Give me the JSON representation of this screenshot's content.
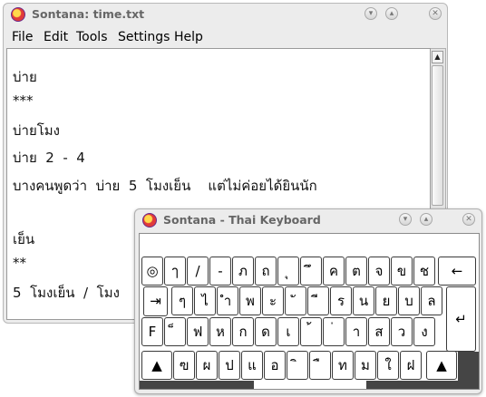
{
  "editor": {
    "title": "Sontana: time.txt",
    "buttons": {
      "minimize": "▾",
      "maximize": "▴",
      "close": "✕"
    },
    "menu": [
      "File",
      "Edit",
      "Tools",
      "Settings",
      "Help"
    ],
    "lines": [
      "บ่าย",
      "***",
      "บ่ายโมง",
      "บ่าย  2  -  4",
      "บางคนพูดว่า  บ่าย  5  โมงเย็น    แต่ไม่ค่อยได้ยินนัก",
      "",
      "เย็น",
      "**",
      "5  โมงเย็น  /  โมง"
    ],
    "scroll_up": "▲"
  },
  "keyboard": {
    "title": "Sontana - Thai Keyboard",
    "buttons": {
      "minimize": "▾",
      "maximize": "▴",
      "close": "✕"
    },
    "row1": [
      "◎",
      "ๅ",
      "/",
      "-",
      "ภ",
      "ถ",
      "ุ",
      "ึ",
      "ค",
      "ต",
      "จ",
      "ข",
      "ช"
    ],
    "backspace": "←",
    "tab": "⇥",
    "row2": [
      "ๆ",
      "ไ",
      "ำ",
      "พ",
      "ะ",
      "ั",
      "ี",
      "ร",
      "น",
      "ย",
      "บ",
      "ล"
    ],
    "enter": "↵",
    "caps": "F",
    "row3": [
      "็",
      "ฟ",
      "ห",
      "ก",
      "ด",
      "เ",
      "้",
      "่",
      "า",
      "ส",
      "ว",
      "ง"
    ],
    "shift_left": "▲",
    "row4": [
      "ฃ",
      "ผ",
      "ป",
      "แ",
      "อ",
      "ิ",
      "ื",
      "ท",
      "ม",
      "ใ",
      "ฝ"
    ],
    "shift_right": "▲"
  }
}
